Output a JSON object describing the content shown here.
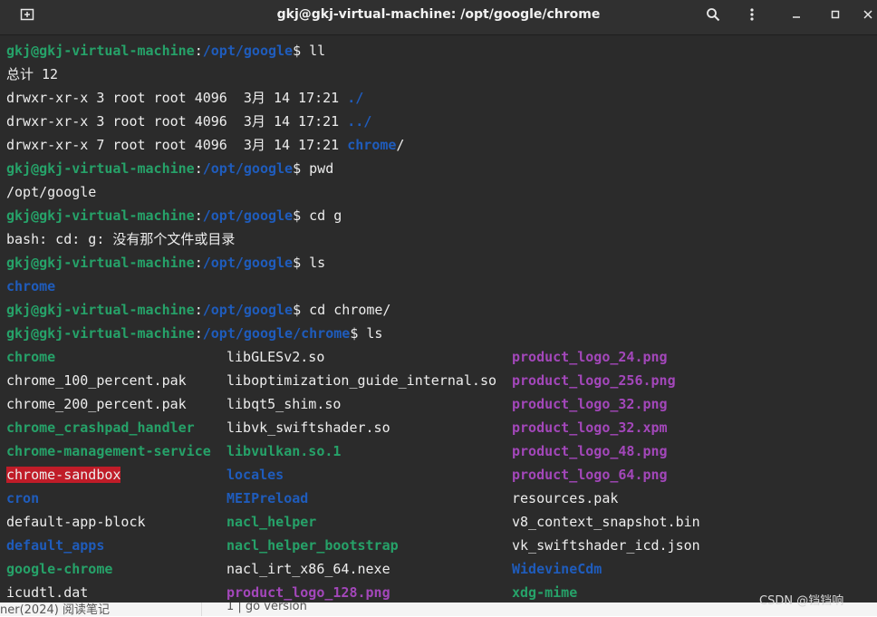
{
  "window": {
    "title": "gkj@gkj-virtual-machine: /opt/google/chrome"
  },
  "icons": {
    "new_tab": "new-tab-icon",
    "search": "search-icon",
    "menu": "hamburger-menu-icon",
    "minimize": "minimize-icon",
    "maximize": "maximize-icon",
    "close": "close-icon"
  },
  "colors": {
    "background": "#2b2b2b",
    "prompt_user": "#26a269",
    "prompt_path": "#1f5cbc",
    "directory": "#1f5cbc",
    "executable": "#26a269",
    "image_file": "#a347ba",
    "highlight_bg": "#c01c28"
  },
  "prompt": {
    "user_host": "gkj@gkj-virtual-machine",
    "colon": ":",
    "path_google": "/opt/google",
    "path_chrome": "/opt/google/chrome",
    "suffix": "$ "
  },
  "terminal": {
    "cmd1": "ll",
    "total": "总计 12",
    "ll_rows": [
      {
        "meta": "drwxr-xr-x 3 root root 4096  3月 14 17:21 ",
        "name": "./",
        "suffix": ""
      },
      {
        "meta": "drwxr-xr-x 3 root root 4096  3月 14 17:21 ",
        "name": "../",
        "suffix": ""
      },
      {
        "meta": "drwxr-xr-x 7 root root 4096  3月 14 17:21 ",
        "name": "chrome",
        "suffix": "/"
      }
    ],
    "cmd2": "pwd",
    "pwd_out": "/opt/google",
    "cmd3": "cd g",
    "cd_err": "bash: cd: g: 没有那个文件或目录",
    "cmd4": "ls",
    "ls_out": "chrome",
    "cmd5": "cd chrome/",
    "cmd6": "ls"
  },
  "ls_chrome": {
    "col1": [
      {
        "name": "chrome",
        "type": "exe"
      },
      {
        "name": "chrome_100_percent.pak",
        "type": "plain"
      },
      {
        "name": "chrome_200_percent.pak",
        "type": "plain"
      },
      {
        "name": "chrome_crashpad_handler",
        "type": "exe"
      },
      {
        "name": "chrome-management-service",
        "type": "exe"
      },
      {
        "name": "chrome-sandbox",
        "type": "sandbox"
      },
      {
        "name": "cron",
        "type": "dir"
      },
      {
        "name": "default-app-block",
        "type": "plain"
      },
      {
        "name": "default_apps",
        "type": "dir"
      },
      {
        "name": "google-chrome",
        "type": "exe"
      },
      {
        "name": "icudtl.dat",
        "type": "plain"
      }
    ],
    "col2": [
      {
        "name": "libGLESv2.so",
        "type": "plain"
      },
      {
        "name": "liboptimization_guide_internal.so",
        "type": "plain"
      },
      {
        "name": "libqt5_shim.so",
        "type": "plain"
      },
      {
        "name": "libvk_swiftshader.so",
        "type": "plain"
      },
      {
        "name": "libvulkan.so.1",
        "type": "exe"
      },
      {
        "name": "locales",
        "type": "dir"
      },
      {
        "name": "MEIPreload",
        "type": "dir"
      },
      {
        "name": "nacl_helper",
        "type": "exe"
      },
      {
        "name": "nacl_helper_bootstrap",
        "type": "exe"
      },
      {
        "name": "nacl_irt_x86_64.nexe",
        "type": "plain"
      },
      {
        "name": "product_logo_128.png",
        "type": "img"
      }
    ],
    "col3": [
      {
        "name": "product_logo_24.png",
        "type": "img"
      },
      {
        "name": "product_logo_256.png",
        "type": "img"
      },
      {
        "name": "product_logo_32.png",
        "type": "img"
      },
      {
        "name": "product_logo_32.xpm",
        "type": "img"
      },
      {
        "name": "product_logo_48.png",
        "type": "img"
      },
      {
        "name": "product_logo_64.png",
        "type": "img"
      },
      {
        "name": "resources.pak",
        "type": "plain"
      },
      {
        "name": "v8_context_snapshot.bin",
        "type": "plain"
      },
      {
        "name": "vk_swiftshader_icd.json",
        "type": "plain"
      },
      {
        "name": "WidevineCdm",
        "type": "dir"
      },
      {
        "name": "xdg-mime",
        "type": "exe"
      }
    ]
  },
  "background_page": {
    "text1": "1 | go version",
    "text2": "ner(2024) 阅读笔记"
  },
  "watermark": "CSDN @铛铛响"
}
